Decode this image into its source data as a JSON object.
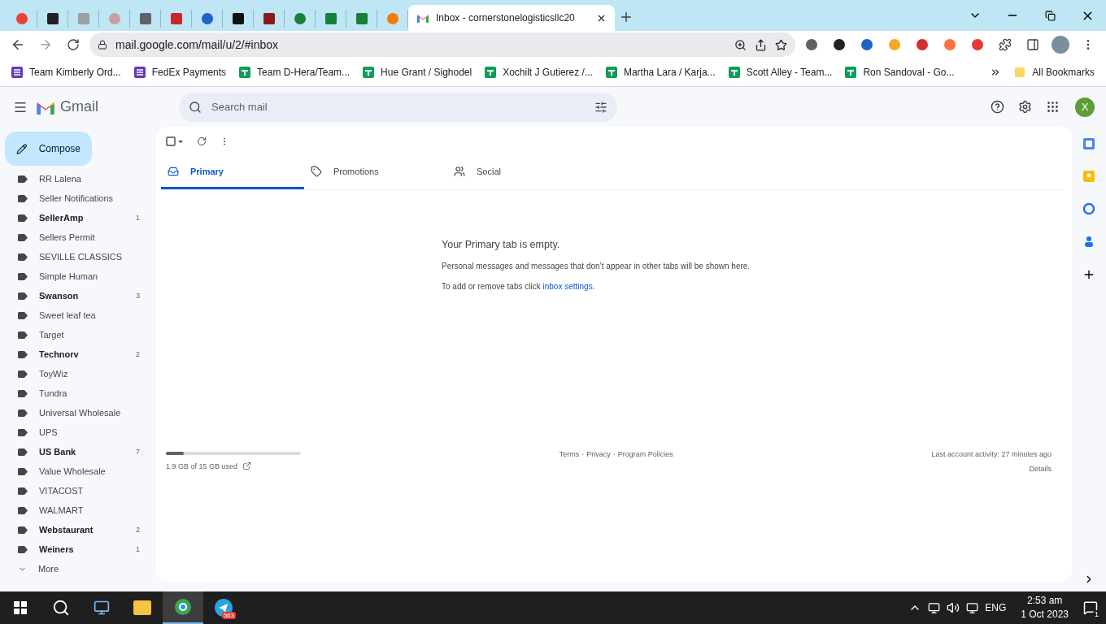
{
  "browser": {
    "tabs": [
      {
        "selected": false
      },
      {
        "selected": false
      },
      {
        "selected": false
      },
      {
        "selected": false
      },
      {
        "selected": false
      },
      {
        "selected": false
      },
      {
        "selected": false
      },
      {
        "selected": false
      },
      {
        "selected": false
      },
      {
        "selected": false
      },
      {
        "selected": false
      },
      {
        "selected": false
      },
      {
        "selected": false
      },
      {
        "title": "Inbox - cornerstonelogisticsllc20",
        "selected": true
      }
    ],
    "address": "mail.google.com/mail/u/2/#inbox",
    "bookmarks": [
      {
        "label": "Team Kimberly Ord...",
        "kind": "forms"
      },
      {
        "label": "FedEx Payments",
        "kind": "forms"
      },
      {
        "label": "Team D-Hera/Team...",
        "kind": "sheets"
      },
      {
        "label": "Hue Grant / Sighodel",
        "kind": "sheets"
      },
      {
        "label": "Xochilt J Gutierez /...",
        "kind": "sheets"
      },
      {
        "label": "Martha Lara / Karja...",
        "kind": "sheets"
      },
      {
        "label": "Scott Alley - Team...",
        "kind": "sheets"
      },
      {
        "label": "Ron Sandoval - Go...",
        "kind": "sheets"
      }
    ],
    "all_bookmarks": "All Bookmarks"
  },
  "gmail": {
    "product": "Gmail",
    "search_placeholder": "Search mail",
    "avatar": "X",
    "compose": "Compose",
    "labels": [
      {
        "name": "RR Lalena",
        "unread": false
      },
      {
        "name": "Seller Notifications",
        "unread": false
      },
      {
        "name": "SellerAmp",
        "unread": true,
        "count": "1"
      },
      {
        "name": "Sellers Permit",
        "unread": false
      },
      {
        "name": "SEVILLE CLASSICS",
        "unread": false
      },
      {
        "name": "Simple Human",
        "unread": false
      },
      {
        "name": "Swanson",
        "unread": true,
        "count": "3"
      },
      {
        "name": "Sweet leaf tea",
        "unread": false
      },
      {
        "name": "Target",
        "unread": false
      },
      {
        "name": "Technorv",
        "unread": true,
        "count": "2"
      },
      {
        "name": "ToyWiz",
        "unread": false
      },
      {
        "name": "Tundra",
        "unread": false
      },
      {
        "name": "Universal Wholesale",
        "unread": false
      },
      {
        "name": "UPS",
        "unread": false
      },
      {
        "name": "US Bank",
        "unread": true,
        "count": "7"
      },
      {
        "name": "Value Wholesale",
        "unread": false
      },
      {
        "name": "VITACOST",
        "unread": false
      },
      {
        "name": "WALMART",
        "unread": false
      },
      {
        "name": "Webstaurant",
        "unread": true,
        "count": "2"
      },
      {
        "name": "Weiners",
        "unread": true,
        "count": "1"
      }
    ],
    "more": "More",
    "select_all": {
      "checked": false
    },
    "tabs": [
      {
        "label": "Primary",
        "kind": "inbox",
        "selected": true
      },
      {
        "label": "Promotions",
        "kind": "tag",
        "selected": false
      },
      {
        "label": "Social",
        "kind": "people",
        "selected": false
      }
    ],
    "empty": {
      "title": "Your Primary tab is empty.",
      "text": "Personal messages and messages that don’t appear in other tabs will be shown here.",
      "hint_before": "To add or remove tabs click ",
      "link": "inbox settings",
      "hint_after": "."
    },
    "storage": {
      "level": 0.13,
      "text": "1.9 GB of 15 GB used"
    },
    "footer_links": [
      "Terms",
      "Privacy",
      "Program Policies"
    ],
    "separator": "·",
    "activity": "Last account activity: 27 minutes ago",
    "details": "Details"
  },
  "taskbar": {
    "telegram_badge": "563",
    "language": "ENG",
    "time": "2:53 am",
    "date": "1 Oct 2023",
    "notifications": "1"
  }
}
